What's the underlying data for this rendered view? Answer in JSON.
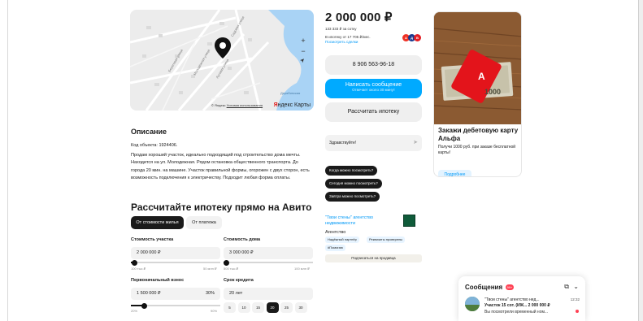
{
  "map": {
    "zoom_in": "+",
    "zoom_out": "−",
    "locate": "➤",
    "street_labels": [
      "Садовая улица",
      "Молодёжная улица",
      "Береговая улица",
      "Луговая улица"
    ],
    "place_label": "Дерябинская",
    "attribution_prefix": "© Яндекс",
    "attribution_link": "Условия использования",
    "logo_first": "Я",
    "logo_rest": "ндекс Карты"
  },
  "description": {
    "title": "Описание",
    "code": "Код объекта: 1924406.",
    "text": "Продам хороший участок, идеально подходящий под строительство дома мечты. Находится на ул. Молодежная. Рядом остановка общественного транспорта. До города 20 мин. на машине. Участок правильной формы, огорожен с двух сторон, есть возможность подключения к электричеству. Подходит любая форма оплаты."
  },
  "mortgage": {
    "title": "Рассчитайте ипотеку прямо на Авито",
    "mode_tabs": [
      "От стоимости жилья",
      "От платежа"
    ],
    "land_label": "Стоимость участка",
    "land_value": "2 000 000 ₽",
    "land_min": "100 тыс.₽",
    "land_max": "50 млн ₽",
    "land_fraction": 0.04,
    "house_label": "Стоимость дома",
    "house_value": "3 000 000 ₽",
    "house_min": "500 тыс.₽",
    "house_max": "100 млн ₽",
    "house_fraction": 0.03,
    "down_label": "Первоначальный взнос",
    "down_value": "1 500 000 ₽",
    "down_percent": "30%",
    "down_min": "20%",
    "down_max": "90%",
    "down_fraction": 0.15,
    "term_label": "Срок кредита",
    "term_value": "20 лет",
    "terms": [
      "5",
      "10",
      "15",
      "20",
      "25",
      "30"
    ],
    "term_selected": "20"
  },
  "listing": {
    "price": "2 000 000 ₽",
    "price_per_sotka": "133 333 ₽ за сотку",
    "mortgage_from": "В ипотеку от 17 705 ₽/мес.",
    "offers_link": "Посмотреть сделки",
    "bank_icons": [
      "А",
      "Д",
      "В"
    ],
    "phone_button": "8 906 563-96-18",
    "write_button": "Написать сообщение",
    "write_sub": "Отвечает около 30 минут",
    "calc_button": "Рассчитать ипотеку"
  },
  "chat": {
    "greeting": "Здравствуйте!",
    "quick_replies": [
      "Когда можно посмотреть?",
      "Сегодня можно посмотреть?",
      "Завтра можно посмотреть?"
    ]
  },
  "seller": {
    "name": "\"Твои стены\" агентство недвижимости",
    "type": "Агентство",
    "badges": [
      "Надёжный партнёр",
      "Реквизиты проверены",
      "#Помогаю"
    ],
    "subscribe": "Подписаться на продавца"
  },
  "ad": {
    "title": "Закажи дебетовую карту Альфа",
    "subtitle": "Получи 1000 руб. при заказе бесплатной карты!",
    "button": "Подробнее",
    "banknote_value": "1000",
    "card_letter": "A"
  },
  "messages": {
    "title": "Сообщения",
    "count": "99+",
    "sender": "\"Твои стены\" агентство нед...",
    "time": "12:32",
    "subject": "Участок 15 сот. (ИЖ...  2 000 000 ₽",
    "preview": "Вы посмотрели временный ном..."
  },
  "colors": {
    "accent_blue": "#00aaff",
    "link_blue": "#0099f7",
    "dark": "#1a1a1a",
    "alert_red": "#ff4053"
  }
}
